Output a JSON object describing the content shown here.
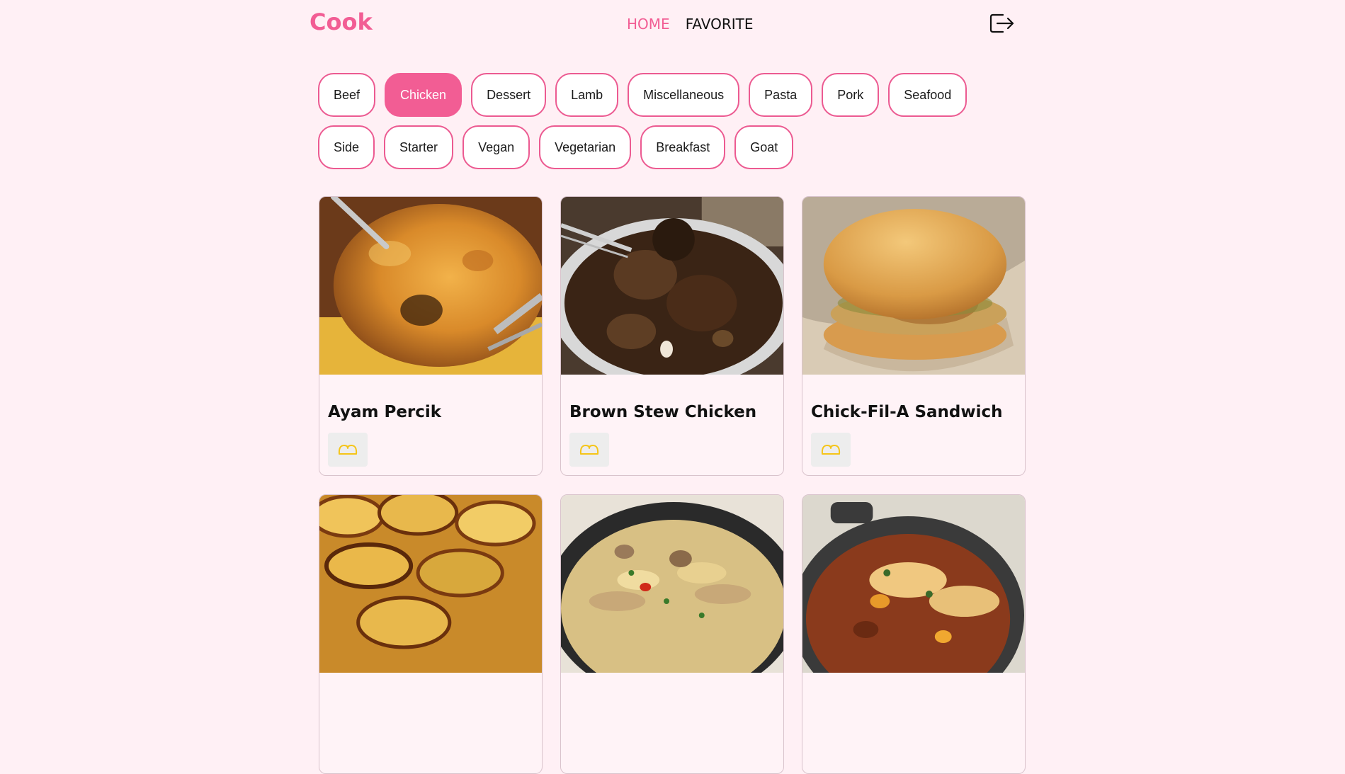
{
  "app": {
    "logo": "Cook",
    "colors": {
      "accent": "#f25d94",
      "background": "#fff0f5",
      "icon_yellow": "#f5c518"
    }
  },
  "nav": {
    "items": [
      {
        "label": "HOME",
        "active": true
      },
      {
        "label": "FAVORITE",
        "active": false
      }
    ],
    "logout_icon": "logout-icon"
  },
  "categories": {
    "selected": "Chicken",
    "items": [
      "Beef",
      "Chicken",
      "Dessert",
      "Lamb",
      "Miscellaneous",
      "Pasta",
      "Pork",
      "Seafood",
      "Side",
      "Starter",
      "Vegan",
      "Vegetarian",
      "Breakfast",
      "Goat"
    ]
  },
  "meals": [
    {
      "title": "Ayam Percik",
      "image": "roasted-chicken-photo",
      "fav_icon": "heart-outline-icon"
    },
    {
      "title": "Brown Stew Chicken",
      "image": "stew-chicken-photo",
      "fav_icon": "heart-outline-icon"
    },
    {
      "title": "Chick-Fil-A Sandwich",
      "image": "chicken-sandwich-photo",
      "fav_icon": "heart-outline-icon"
    },
    {
      "title": "",
      "image": "potato-gratin-photo",
      "fav_icon": "heart-outline-icon"
    },
    {
      "title": "",
      "image": "chicken-pasta-skillet-photo",
      "fav_icon": "heart-outline-icon"
    },
    {
      "title": "",
      "image": "chicken-casserole-pan-photo",
      "fav_icon": "heart-outline-icon"
    }
  ]
}
